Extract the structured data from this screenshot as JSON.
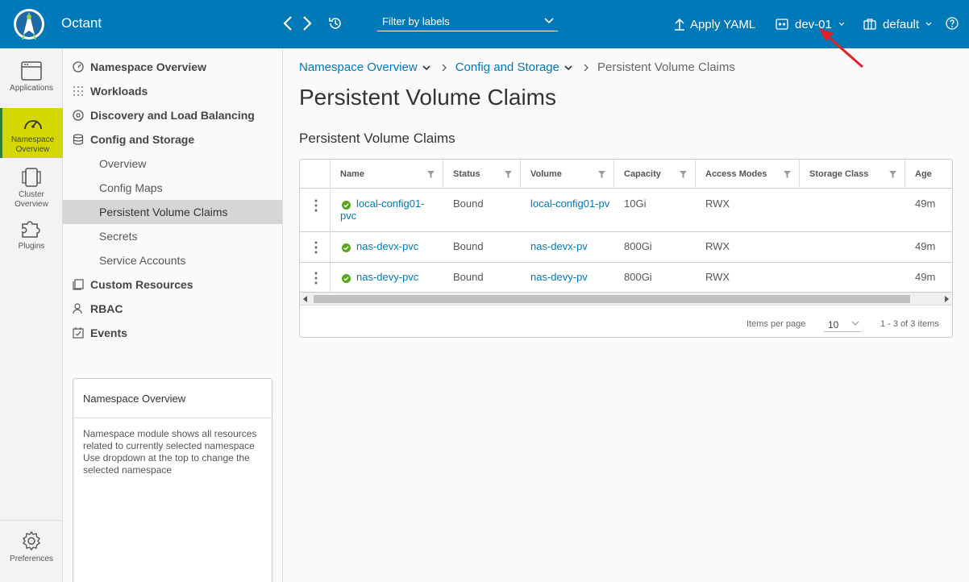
{
  "header": {
    "app_title": "Octant",
    "filter_placeholder": "Filter by labels",
    "apply_yaml": "Apply YAML",
    "context": "dev-01",
    "namespace": "default"
  },
  "rail": {
    "items": [
      {
        "label": "Applications"
      },
      {
        "label": "Namespace Overview"
      },
      {
        "label": "Cluster Overview"
      },
      {
        "label": "Plugins"
      },
      {
        "label": "Preferences"
      }
    ]
  },
  "subnav": {
    "groups": {
      "namespace_overview": "Namespace Overview",
      "workloads": "Workloads",
      "discovery": "Discovery and Load Balancing",
      "config_storage": "Config and Storage",
      "custom_resources": "Custom Resources",
      "rbac": "RBAC",
      "events": "Events"
    },
    "children": {
      "overview": "Overview",
      "config_maps": "Config Maps",
      "pvc": "Persistent Volume Claims",
      "secrets": "Secrets",
      "service_accounts": "Service Accounts"
    }
  },
  "help_card": {
    "title": "Namespace Overview",
    "body": "Namespace module shows all resources related to currently selected namespace Use dropdown at the top to change the selected namespace"
  },
  "breadcrumb": {
    "item1": "Namespace Overview",
    "item2": "Config and Storage",
    "current": "Persistent Volume Claims"
  },
  "page_title": "Persistent Volume Claims",
  "section_title": "Persistent Volume Claims",
  "table": {
    "columns": [
      "Name",
      "Status",
      "Volume",
      "Capacity",
      "Access Modes",
      "Storage Class",
      "Age"
    ],
    "rows": [
      {
        "name": "local-config01-pvc",
        "status": "Bound",
        "volume": "local-config01-pv",
        "capacity": "10Gi",
        "access": "RWX",
        "storage_class": "",
        "age": "49m"
      },
      {
        "name": "nas-devx-pvc",
        "status": "Bound",
        "volume": "nas-devx-pv",
        "capacity": "800Gi",
        "access": "RWX",
        "storage_class": "",
        "age": "49m"
      },
      {
        "name": "nas-devy-pvc",
        "status": "Bound",
        "volume": "nas-devy-pv",
        "capacity": "800Gi",
        "access": "RWX",
        "storage_class": "",
        "age": "49m"
      }
    ],
    "items_per_page_label": "Items per page",
    "items_per_page": "10",
    "page_info": "1 - 3 of 3 items"
  },
  "colors": {
    "header_bg": "#0079b8",
    "link": "#0079b8",
    "active_rail": "#d4d800",
    "status_ok": "#5aa220",
    "arrow": "#e12222"
  }
}
